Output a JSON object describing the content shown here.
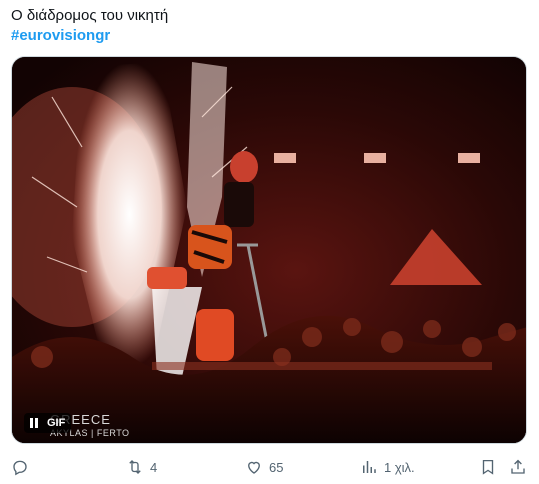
{
  "tweet": {
    "text": "Ο διάδρομος του νικητή",
    "hashtag": "#eurovisiongr"
  },
  "media": {
    "badge": "GIF",
    "overlay_line1": "GREECE",
    "overlay_line2": "AKYLAS | FERTO"
  },
  "actions": {
    "replies": "",
    "reposts": "4",
    "likes": "65",
    "views": "1 χιλ."
  },
  "colors": {
    "accent": "#1d9bf0",
    "muted": "#536471"
  }
}
